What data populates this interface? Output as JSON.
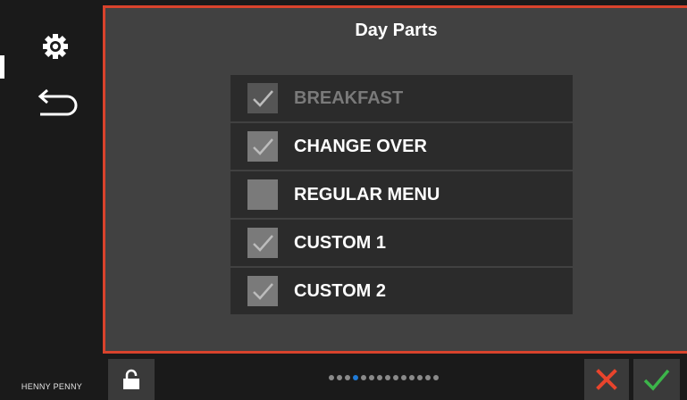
{
  "panel": {
    "title": "Day Parts"
  },
  "day_parts": [
    {
      "label": "BREAKFAST",
      "checked": true,
      "disabled": true
    },
    {
      "label": "CHANGE OVER",
      "checked": true,
      "disabled": false
    },
    {
      "label": "REGULAR MENU",
      "checked": false,
      "disabled": false
    },
    {
      "label": "CUSTOM 1",
      "checked": true,
      "disabled": false
    },
    {
      "label": "CUSTOM 2",
      "checked": true,
      "disabled": false
    }
  ],
  "sidebar": {
    "icons": [
      "gear-icon",
      "back-arrow-icon"
    ]
  },
  "footer": {
    "brand": "HENNY PENNY",
    "page_count": 14,
    "active_page": 4,
    "icons": [
      "lock-icon",
      "close-icon",
      "check-icon"
    ]
  },
  "colors": {
    "accent_border": "#d9432c",
    "cancel": "#e8442c",
    "confirm": "#3cb54a",
    "active_dot": "#1f7ad6"
  }
}
